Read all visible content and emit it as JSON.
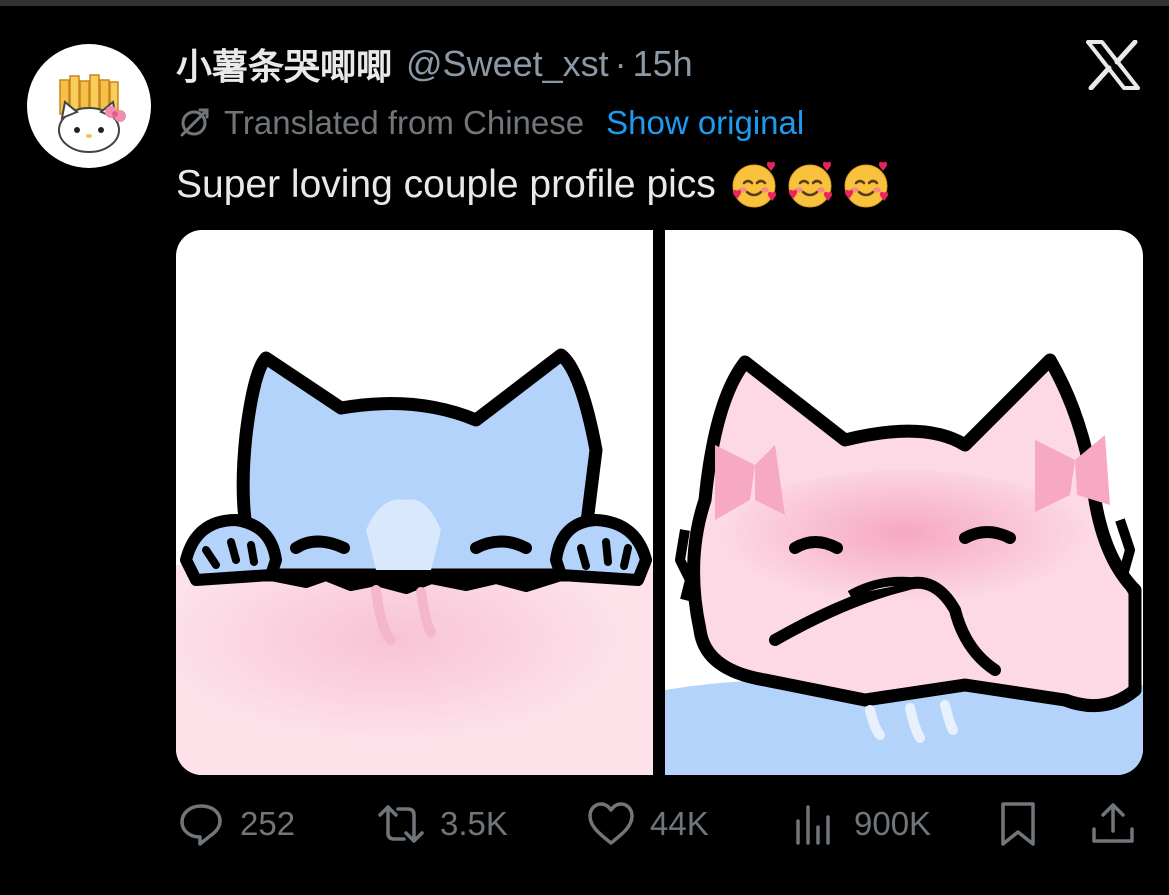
{
  "tweet": {
    "display_name": "小薯条哭唧唧",
    "handle": "@Sweet_xst",
    "separator": "·",
    "time": "15h",
    "translated_label": "Translated from Chinese",
    "show_original": "Show original",
    "text": "Super loving couple profile pics",
    "emoji_names": [
      "smiling-face-with-hearts",
      "smiling-face-with-hearts",
      "smiling-face-with-hearts"
    ]
  },
  "media": {
    "images": [
      {
        "name": "blue-cat-peeking",
        "description_color": "#b3d3fb"
      },
      {
        "name": "pink-cat-with-bows",
        "description_color": "#fcd9e4"
      }
    ]
  },
  "actions": {
    "replies": "252",
    "reposts": "3.5K",
    "likes": "44K",
    "views": "900K"
  },
  "icons": {
    "brand": "x-logo",
    "translate": "translate-icon",
    "reply": "reply-icon",
    "repost": "repost-icon",
    "like": "heart-icon",
    "views": "views-icon",
    "bookmark": "bookmark-icon",
    "share": "share-icon"
  },
  "colors": {
    "background": "#000000",
    "text": "#e7e9ea",
    "muted": "#71767b",
    "link": "#1d9bf0",
    "blue_cat": "#b3d3fb",
    "pink_cat": "#fcd9e4"
  }
}
